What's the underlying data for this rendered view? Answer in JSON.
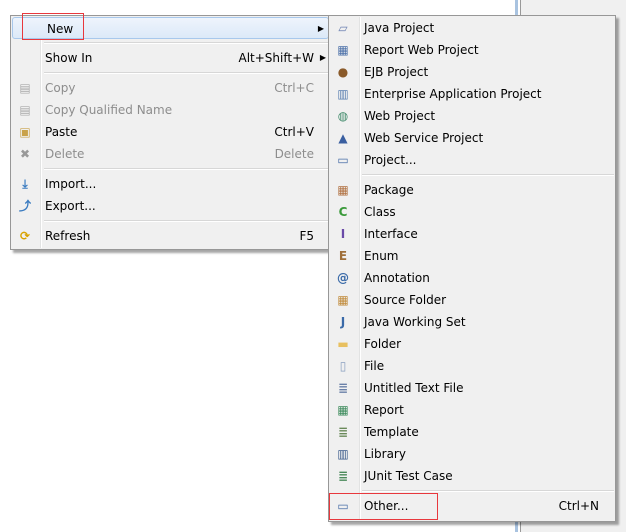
{
  "context_menu": {
    "items": [
      {
        "label": "New",
        "shortcut": "",
        "submenu": true,
        "icon": "none",
        "enabled": true,
        "highlighted": true
      },
      {
        "separator": true
      },
      {
        "label": "Show In",
        "shortcut": "Alt+Shift+W",
        "submenu": true,
        "icon": "none",
        "enabled": true
      },
      {
        "separator": true
      },
      {
        "label": "Copy",
        "shortcut": "Ctrl+C",
        "icon": "copy-icon",
        "enabled": false
      },
      {
        "label": "Copy Qualified Name",
        "shortcut": "",
        "icon": "copy-qualified-name-icon",
        "enabled": false
      },
      {
        "label": "Paste",
        "shortcut": "Ctrl+V",
        "icon": "paste-icon",
        "enabled": true
      },
      {
        "label": "Delete",
        "shortcut": "Delete",
        "icon": "delete-icon",
        "enabled": false
      },
      {
        "separator": true
      },
      {
        "label": "Import...",
        "shortcut": "",
        "icon": "import-icon",
        "enabled": true
      },
      {
        "label": "Export...",
        "shortcut": "",
        "icon": "export-icon",
        "enabled": true
      },
      {
        "separator": true
      },
      {
        "label": "Refresh",
        "shortcut": "F5",
        "icon": "refresh-icon",
        "enabled": true
      }
    ]
  },
  "new_submenu": {
    "items": [
      {
        "label": "Java Project",
        "icon": "java-project-icon"
      },
      {
        "label": "Report Web Project",
        "icon": "report-web-project-icon"
      },
      {
        "label": "EJB Project",
        "icon": "ejb-project-icon"
      },
      {
        "label": "Enterprise Application Project",
        "icon": "enterprise-application-project-icon"
      },
      {
        "label": "Web Project",
        "icon": "web-project-icon"
      },
      {
        "label": "Web Service Project",
        "icon": "web-service-project-icon"
      },
      {
        "label": "Project...",
        "icon": "project-icon"
      },
      {
        "separator": true
      },
      {
        "label": "Package",
        "icon": "package-icon"
      },
      {
        "label": "Class",
        "icon": "class-icon"
      },
      {
        "label": "Interface",
        "icon": "interface-icon"
      },
      {
        "label": "Enum",
        "icon": "enum-icon"
      },
      {
        "label": "Annotation",
        "icon": "annotation-icon"
      },
      {
        "label": "Source Folder",
        "icon": "source-folder-icon"
      },
      {
        "label": "Java Working Set",
        "icon": "java-working-set-icon"
      },
      {
        "label": "Folder",
        "icon": "folder-icon"
      },
      {
        "label": "File",
        "icon": "file-icon"
      },
      {
        "label": "Untitled Text File",
        "icon": "untitled-text-file-icon"
      },
      {
        "label": "Report",
        "icon": "report-icon"
      },
      {
        "label": "Template",
        "icon": "template-icon"
      },
      {
        "label": "Library",
        "icon": "library-icon"
      },
      {
        "label": "JUnit Test Case",
        "icon": "junit-test-case-icon"
      },
      {
        "separator": true
      },
      {
        "label": "Other...",
        "shortcut": "Ctrl+N",
        "icon": "other-icon",
        "annotated": true
      }
    ]
  },
  "annotation_color": "#e8383d"
}
